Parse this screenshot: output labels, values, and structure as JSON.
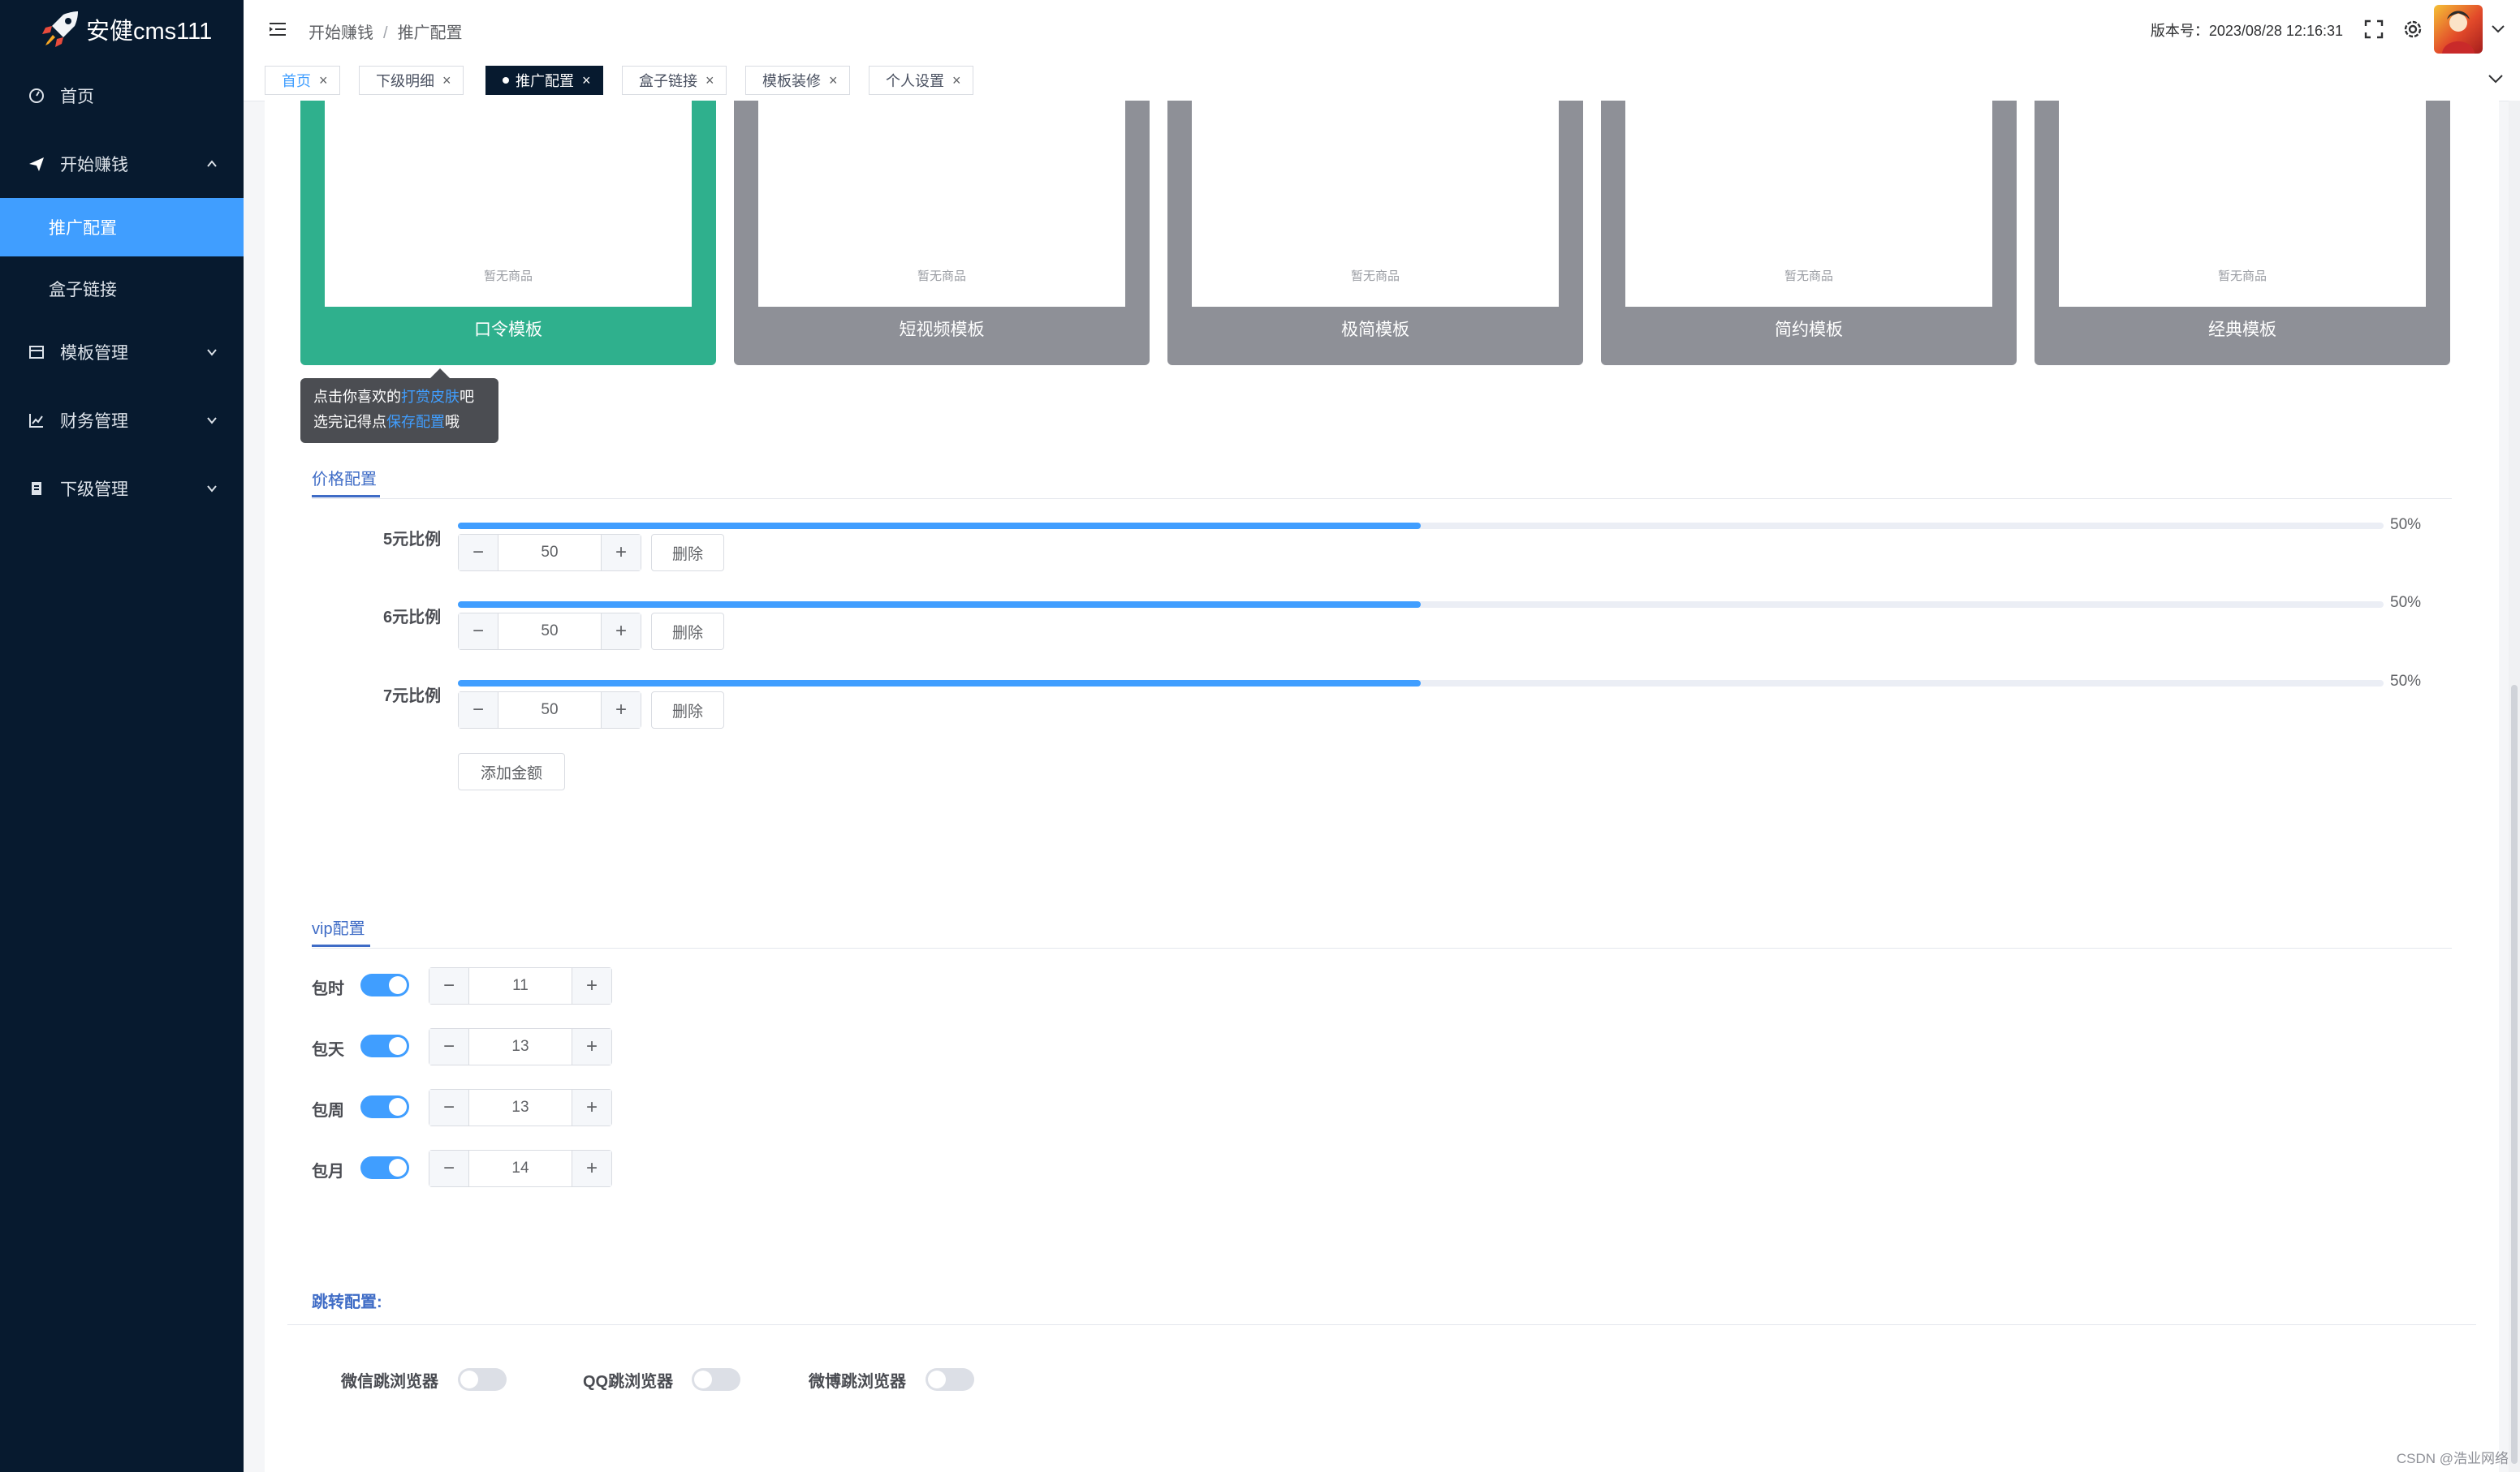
{
  "app": {
    "name": "安健cms111"
  },
  "sidebar": {
    "items": [
      {
        "label": "首页",
        "icon": "dashboard-icon"
      },
      {
        "label": "开始赚钱",
        "icon": "paper-plane-icon",
        "expanded": true
      },
      {
        "label": "推广配置",
        "sub": true,
        "active": true
      },
      {
        "label": "盒子链接",
        "sub": true
      },
      {
        "label": "模板管理",
        "icon": "template-icon"
      },
      {
        "label": "财务管理",
        "icon": "chart-icon"
      },
      {
        "label": "下级管理",
        "icon": "document-icon"
      }
    ]
  },
  "header": {
    "breadcrumb": [
      "开始赚钱",
      "推广配置"
    ],
    "version": "版本号：2023/08/28 12:16:31"
  },
  "tags": [
    {
      "label": "首页"
    },
    {
      "label": "下级明细"
    },
    {
      "label": "推广配置",
      "current": true
    },
    {
      "label": "盒子链接"
    },
    {
      "label": "模板装修"
    },
    {
      "label": "个人设置"
    }
  ],
  "templates": [
    {
      "name": "口令模板",
      "empty": "暂无商品",
      "selected": true
    },
    {
      "name": "短视频模板",
      "empty": "暂无商品"
    },
    {
      "name": "极简模板",
      "empty": "暂无商品"
    },
    {
      "name": "简约模板",
      "empty": "暂无商品"
    },
    {
      "name": "经典模板",
      "empty": "暂无商品"
    }
  ],
  "tooltip": {
    "line1_a": "点击你喜欢的",
    "line1_hl": "打赏皮肤",
    "line1_b": "吧",
    "line2_a": "选完记得点",
    "line2_hl": "保存配置",
    "line2_b": "哦"
  },
  "price_config": {
    "title": "价格配置",
    "rows": [
      {
        "label": "5元比例",
        "percent": 50,
        "percent_text": "50%",
        "value": "50",
        "delete": "删除"
      },
      {
        "label": "6元比例",
        "percent": 50,
        "percent_text": "50%",
        "value": "50",
        "delete": "删除"
      },
      {
        "label": "7元比例",
        "percent": 50,
        "percent_text": "50%",
        "value": "50",
        "delete": "删除"
      }
    ],
    "add_label": "添加金额"
  },
  "vip_config": {
    "title": "vip配置",
    "rows": [
      {
        "label": "包时",
        "enabled": true,
        "value": "11"
      },
      {
        "label": "包天",
        "enabled": true,
        "value": "13"
      },
      {
        "label": "包周",
        "enabled": true,
        "value": "13"
      },
      {
        "label": "包月",
        "enabled": true,
        "value": "14"
      }
    ]
  },
  "jump_config": {
    "title": "跳转配置:",
    "items": [
      {
        "label": "微信跳浏览器",
        "enabled": false
      },
      {
        "label": "QQ跳浏览器",
        "enabled": false
      },
      {
        "label": "微博跳浏览器",
        "enabled": false
      }
    ]
  },
  "watermark": "CSDN @浩业网络",
  "colors": {
    "sidebar_bg": "#071a2f",
    "accent": "#409eff",
    "selected_template": "#2fb08d",
    "template_gray": "#8e9097"
  }
}
